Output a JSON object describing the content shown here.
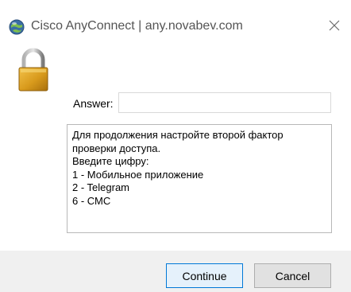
{
  "window": {
    "title": "Cisco AnyConnect | any.novabev.com",
    "app_icon": "cisco-anyconnect-globe-icon",
    "close_icon": "close-icon"
  },
  "prompt": {
    "lock_icon": "lock-icon",
    "answer_label": "Answer:",
    "answer_value": "",
    "message_lines": [
      "Для продолжения настройте второй фактор",
      "проверки доступа.",
      "Введите цифру:",
      "1 - Мобильное приложение",
      "2 - Telegram",
      "6 - СМС"
    ]
  },
  "footer": {
    "continue_label": "Continue",
    "cancel_label": "Cancel"
  },
  "colors": {
    "footer_bg": "#f0f0f0",
    "default_button_border": "#0078d7",
    "lock_body": "#d89a1c",
    "lock_shackle": "#8a8a8a"
  }
}
